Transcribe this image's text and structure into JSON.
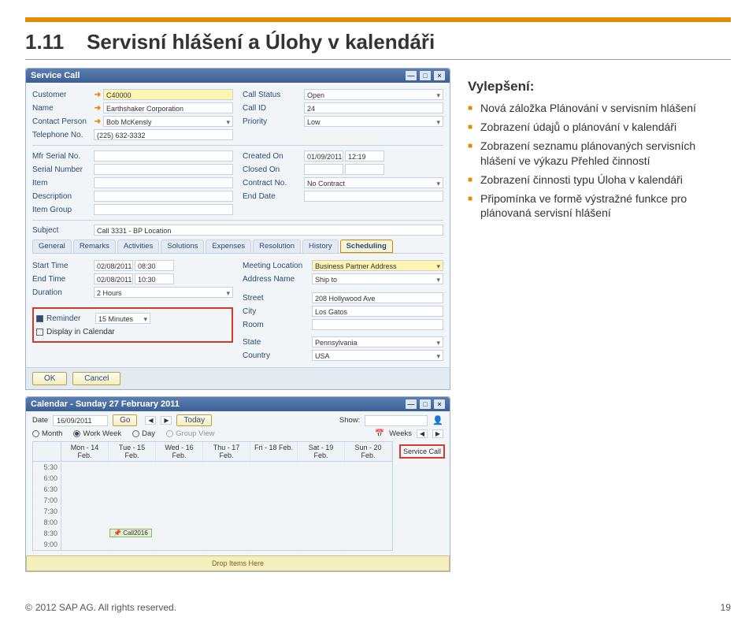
{
  "page": {
    "section_no": "1.11",
    "title": "Servisní hlášení a Úlohy v kalendáři",
    "improvements_heading": "Vylepšení:",
    "bullets": [
      "Nová záložka Plánování v servisním hlášení",
      "Zobrazení údajů o plánování v kalendáři",
      "Zobrazení seznamu plánovaných servisních hlášení ve  výkazu Přehled činností",
      "Zobrazení činnosti typu Úloha v kalendáři",
      "Připomínka ve formě  výstražné funkce pro plánovaná servisní hlášení"
    ],
    "copyright": "2012 SAP AG. All rights reserved.",
    "page_no": "19"
  },
  "svc": {
    "title": "Service Call",
    "left_labels": {
      "customer": "Customer",
      "name": "Name",
      "contact": "Contact Person",
      "tel": "Telephone No.",
      "mfr": "Mfr Serial No.",
      "serial": "Serial Number",
      "item": "Item",
      "desc": "Description",
      "group": "Item Group",
      "subject": "Subject"
    },
    "right_labels": {
      "status": "Call Status",
      "callid": "Call ID",
      "priority": "Priority",
      "created": "Created On",
      "closed": "Closed On",
      "contract": "Contract No.",
      "enddate": "End Date"
    },
    "customer": "C40000",
    "name": "Earthshaker Corporation",
    "contact": "Bob McKensly",
    "tel": "(225) 632-3332",
    "status": "Open",
    "callid": "24",
    "priority": "Low",
    "created_date": "01/09/2011",
    "created_time": "12:19",
    "contract": "No Contract",
    "subject": "Call 3331 - BP Location",
    "tabs": [
      "General",
      "Remarks",
      "Activities",
      "Solutions",
      "Expenses",
      "Resolution",
      "History",
      "Scheduling"
    ],
    "sched": {
      "start_lbl": "Start Time",
      "end_lbl": "End Time",
      "dur_lbl": "Duration",
      "start_date": "02/08/2011",
      "start_time": "08:30",
      "end_date": "02/08/2011",
      "end_time": "10:30",
      "duration": "2 Hours",
      "reminder_lbl": "Reminder",
      "reminder_val": "15 Minutes",
      "display_lbl": "Display in Calendar",
      "mloc_lbl": "Meeting Location",
      "mloc": "Business Partner Address",
      "addr_lbl": "Address Name",
      "addr": "Ship to",
      "street_lbl": "Street",
      "street": "208 Hollywood Ave",
      "city_lbl": "City",
      "city": "Los Gatos",
      "room_lbl": "Room",
      "state_lbl": "State",
      "state": "Pennsylvania",
      "country_lbl": "Country",
      "country": "USA"
    },
    "ok": "OK",
    "cancel": "Cancel"
  },
  "cal": {
    "title": "Calendar - Sunday 27 February 2011",
    "date_lbl": "Date",
    "date": "16/09/2011",
    "go": "Go",
    "today": "Today",
    "show_lbl": "Show:",
    "views": {
      "month": "Month",
      "ww": "Work Week",
      "day": "Day",
      "gv": "Group View"
    },
    "weeks_lbl": "Weeks",
    "days": [
      "Mon - 14 Feb.",
      "Tue - 15 Feb.",
      "Wed - 16 Feb.",
      "Thu - 17 Feb.",
      "Fri - 18 Feb.",
      "Sat - 19 Feb.",
      "Sun - 20 Feb."
    ],
    "side": "Service Call",
    "times": [
      "5:30",
      "6:00",
      "6:30",
      "7:00",
      "7:30",
      "8:00",
      "8:30",
      "9:00"
    ],
    "event": "Call2016",
    "drop": "Drop Items Here"
  }
}
